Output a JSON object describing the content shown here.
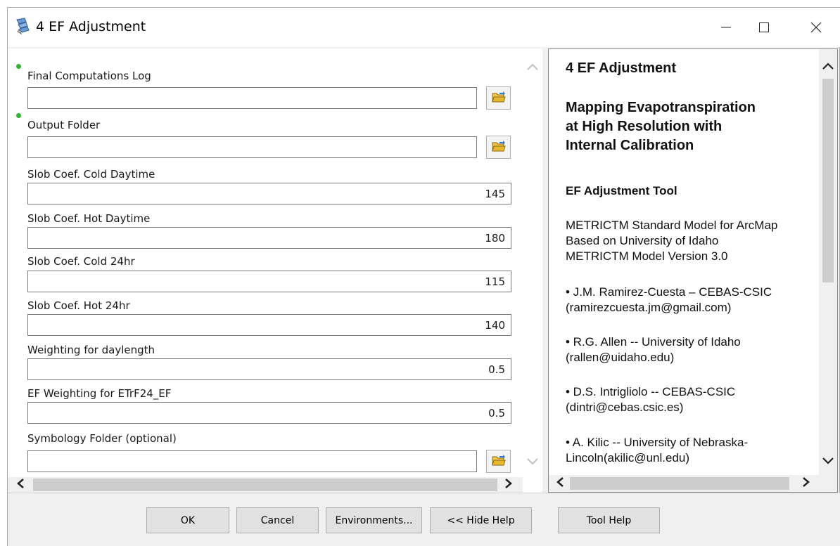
{
  "window": {
    "title": "4 EF Adjustment",
    "app_icon": "arcgis-tool-icon",
    "controls": [
      "minimize-icon",
      "maximize-icon",
      "close-icon"
    ]
  },
  "params": {
    "final_log": {
      "label": "Final Computations Log",
      "value": "",
      "required": true
    },
    "output_folder": {
      "label": "Output Folder",
      "value": "",
      "required": true
    },
    "slob_cold_day": {
      "label": "Slob Coef. Cold Daytime",
      "value": "145"
    },
    "slob_hot_day": {
      "label": "Slob Coef. Hot Daytime",
      "value": "180"
    },
    "slob_cold_24": {
      "label": "Slob Coef. Cold 24hr",
      "value": "115"
    },
    "slob_hot_24": {
      "label": "Slob Coef. Hot 24hr",
      "value": "140"
    },
    "weighting_daylength": {
      "label": "Weighting for daylength",
      "value": "0.5"
    },
    "ef_weighting": {
      "label": "EF Weighting for ETrF24_EF",
      "value": "0.5"
    },
    "symbology_folder": {
      "label": "Symbology Folder (optional)",
      "value": ""
    }
  },
  "help": {
    "title": "4 EF Adjustment",
    "subtitle_lines": [
      "Mapping Evapotranspiration",
      "at High Resolution with",
      "Internal Calibration"
    ],
    "tool_heading": "EF Adjustment Tool",
    "model_lines": [
      "METRICTM Standard Model for ArcMap",
      "Based on University of Idaho",
      "METRICTM Model Version 3.0"
    ],
    "authors": [
      {
        "line1": "• J.M. Ramirez-Cuesta – CEBAS-CSIC",
        "line2": "(ramirezcuesta.jm@gmail.com)"
      },
      {
        "line1": "• R.G. Allen -- University of Idaho",
        "line2": "(rallen@uidaho.edu)"
      },
      {
        "line1": "• D.S. Intrigliolo -- CEBAS-CSIC",
        "line2": "(dintri@cebas.csic.es)"
      },
      {
        "line1": "• A. Kilic -- University of Nebraska-",
        "line2": "Lincoln(akilic@unl.edu)"
      }
    ]
  },
  "buttons": {
    "ok": "OK",
    "cancel": "Cancel",
    "environments": "Environments...",
    "hide_help": "<< Hide Help",
    "tool_help": "Tool Help"
  },
  "colors": {
    "required_dot": "#2db52d",
    "folder_icon": "#e8b730"
  }
}
